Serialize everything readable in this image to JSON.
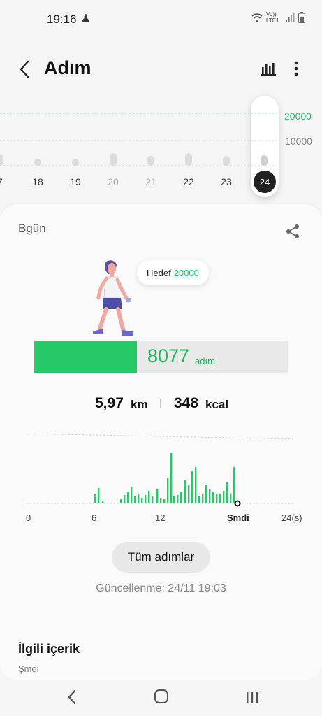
{
  "status_bar": {
    "time": "19:16",
    "network": "Vo)) LTE1",
    "icons": [
      "person-icon",
      "wifi-icon",
      "signal-icon",
      "battery-icon"
    ]
  },
  "header": {
    "title": "Adım",
    "icons": [
      "back-icon",
      "bar-chart-icon",
      "more-vert-icon"
    ]
  },
  "week_chart": {
    "goal_label": "20000",
    "mid_label": "10000",
    "days": [
      {
        "label": "7",
        "dim": false,
        "steps": 9000
      },
      {
        "label": "18",
        "dim": false,
        "steps": 2500
      },
      {
        "label": "19",
        "dim": false,
        "steps": 1500
      },
      {
        "label": "20",
        "dim": true,
        "steps": 9500
      },
      {
        "label": "21",
        "dim": true,
        "steps": 7500
      },
      {
        "label": "22",
        "dim": false,
        "steps": 9500
      },
      {
        "label": "23",
        "dim": false,
        "steps": 7500
      },
      {
        "label": "24",
        "dim": false,
        "steps": 8077,
        "selected": true
      }
    ]
  },
  "today": {
    "label": "Bgün",
    "goal_prefix": "Hedef",
    "goal_value": "20000",
    "steps": "8077",
    "steps_unit": "adım",
    "progress_fraction": 0.40385,
    "distance_value": "5,97",
    "distance_unit": "km",
    "energy_value": "348",
    "energy_unit": "kcal"
  },
  "day_chart": {
    "x_labels": [
      "0",
      "6",
      "12",
      "Şmdi",
      "24(s)"
    ]
  },
  "buttons": {
    "all_steps": "Tüm adımlar"
  },
  "updated": "Güncellenme: 24/11 19:03",
  "related": {
    "title": "İlgili içerik",
    "subtitle": "Şmdi"
  },
  "colors": {
    "accent": "#27c867",
    "accent_text": "#1fb35a"
  }
}
